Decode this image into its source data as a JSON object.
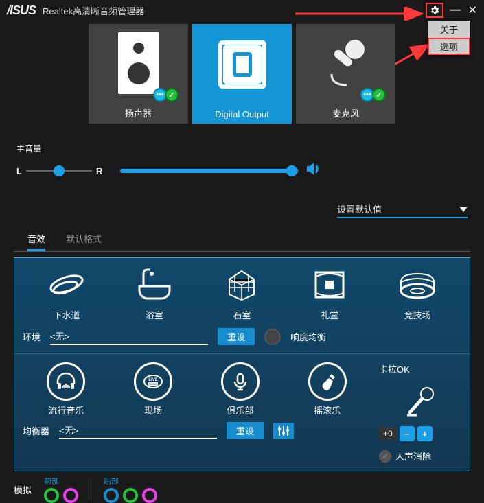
{
  "titlebar": {
    "title": "Realtek高清晰音频管理器"
  },
  "gear_menu": {
    "about": "关于",
    "options": "选项"
  },
  "devices": {
    "speakers": "扬声器",
    "digital": "Digital Output",
    "mic": "麦克风"
  },
  "main_volume": {
    "label": "主音量",
    "left": "L",
    "right": "R"
  },
  "defaults": {
    "label": "设置默认值"
  },
  "tabs": {
    "effects": "音效",
    "format": "默认格式"
  },
  "env": {
    "label": "环境",
    "none": "<无>",
    "reset": "重设",
    "loudness": "响度均衡",
    "items": [
      "下水道",
      "浴室",
      "石室",
      "礼堂",
      "竞技场"
    ]
  },
  "eq": {
    "label": "均衡器",
    "none": "<无>",
    "reset": "重设",
    "items": [
      "流行音乐",
      "现场",
      "俱乐部",
      "摇滚乐"
    ]
  },
  "karaoke": {
    "title": "卡拉OK",
    "value": "+0",
    "voice_cancel": "人声消除"
  },
  "bottom": {
    "front": "前部",
    "rear": "后部",
    "analog": "模拟"
  }
}
